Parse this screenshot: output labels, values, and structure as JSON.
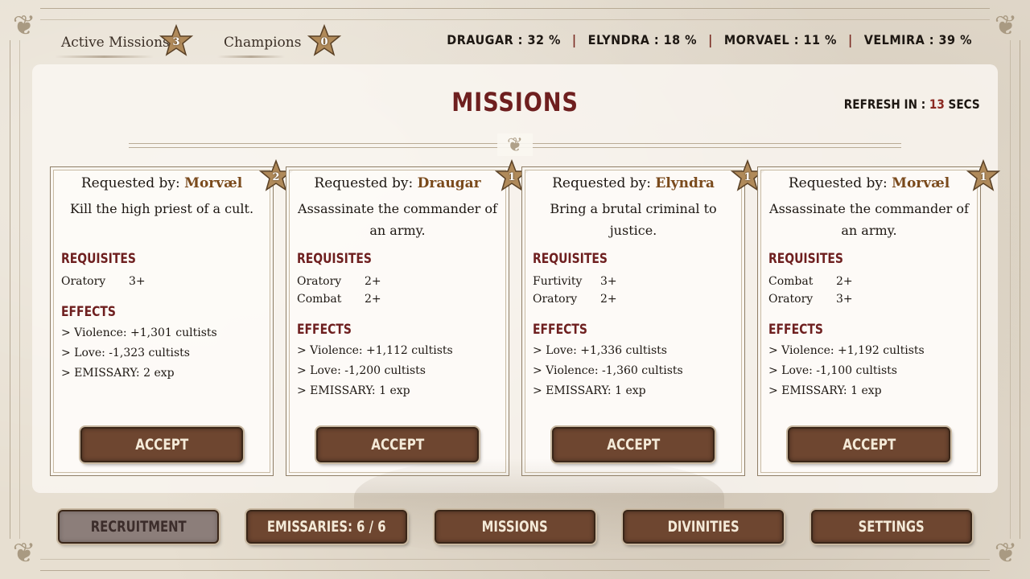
{
  "topbar": {
    "tabs": [
      {
        "label": "Active Missions",
        "badge": "3"
      },
      {
        "label": "Champions",
        "badge": "0"
      }
    ],
    "factions": [
      {
        "text": "DRAUGAR : 32 %"
      },
      {
        "text": "ELYNDRA : 18 %"
      },
      {
        "text": "MORVAEL : 11 %"
      },
      {
        "text": "VELMIRA : 39 %"
      }
    ],
    "separator": "|"
  },
  "panel": {
    "title": "MISSIONS",
    "refresh_label": "REFRESH IN :",
    "refresh_value": "13",
    "refresh_unit": "SECS",
    "requisites_label": "REQUISITES",
    "effects_label": "EFFECTS",
    "requested_by_label": "Requested by:"
  },
  "missions": [
    {
      "requester": "Morvæl",
      "badge": "2",
      "description": "Kill the high priest of a cult.",
      "requisites": [
        {
          "name": "Oratory",
          "level": "3+"
        }
      ],
      "effects": [
        "> Violence: +1,301 cultists",
        "> Love: -1,323 cultists",
        "> EMISSARY: 2 exp"
      ],
      "accept_label": "ACCEPT"
    },
    {
      "requester": "Draugar",
      "badge": "1",
      "description": "Assassinate the commander of an army.",
      "requisites": [
        {
          "name": "Oratory",
          "level": "2+"
        },
        {
          "name": "Combat",
          "level": "2+"
        }
      ],
      "effects": [
        "> Violence: +1,112 cultists",
        "> Love: -1,200 cultists",
        "> EMISSARY: 1 exp"
      ],
      "accept_label": "ACCEPT"
    },
    {
      "requester": "Elyndra",
      "badge": "1",
      "description": "Bring a brutal criminal to justice.",
      "requisites": [
        {
          "name": "Furtivity",
          "level": "3+"
        },
        {
          "name": "Oratory",
          "level": "2+"
        }
      ],
      "effects": [
        "> Love: +1,336 cultists",
        "> Violence: -1,360 cultists",
        "> EMISSARY: 1 exp"
      ],
      "accept_label": "ACCEPT"
    },
    {
      "requester": "Morvæl",
      "badge": "1",
      "description": "Assassinate the commander of an army.",
      "requisites": [
        {
          "name": "Combat",
          "level": "2+"
        },
        {
          "name": "Oratory",
          "level": "3+"
        }
      ],
      "effects": [
        "> Violence: +1,192 cultists",
        "> Love: -1,100 cultists",
        "> EMISSARY: 1 exp"
      ],
      "accept_label": "ACCEPT"
    }
  ],
  "nav": [
    {
      "label": "RECRUITMENT",
      "state": "disabled"
    },
    {
      "label": "EMISSARIES: 6 / 6",
      "state": "active"
    },
    {
      "label": "MISSIONS",
      "state": "active"
    },
    {
      "label": "DIVINITIES",
      "state": "active"
    },
    {
      "label": "SETTINGS",
      "state": "active"
    }
  ],
  "colors": {
    "accent_red": "#6e1f1f",
    "button_brown": "#6e4630",
    "requester_gold": "#7a4a1c",
    "badge_tan": "#b08a5a"
  }
}
